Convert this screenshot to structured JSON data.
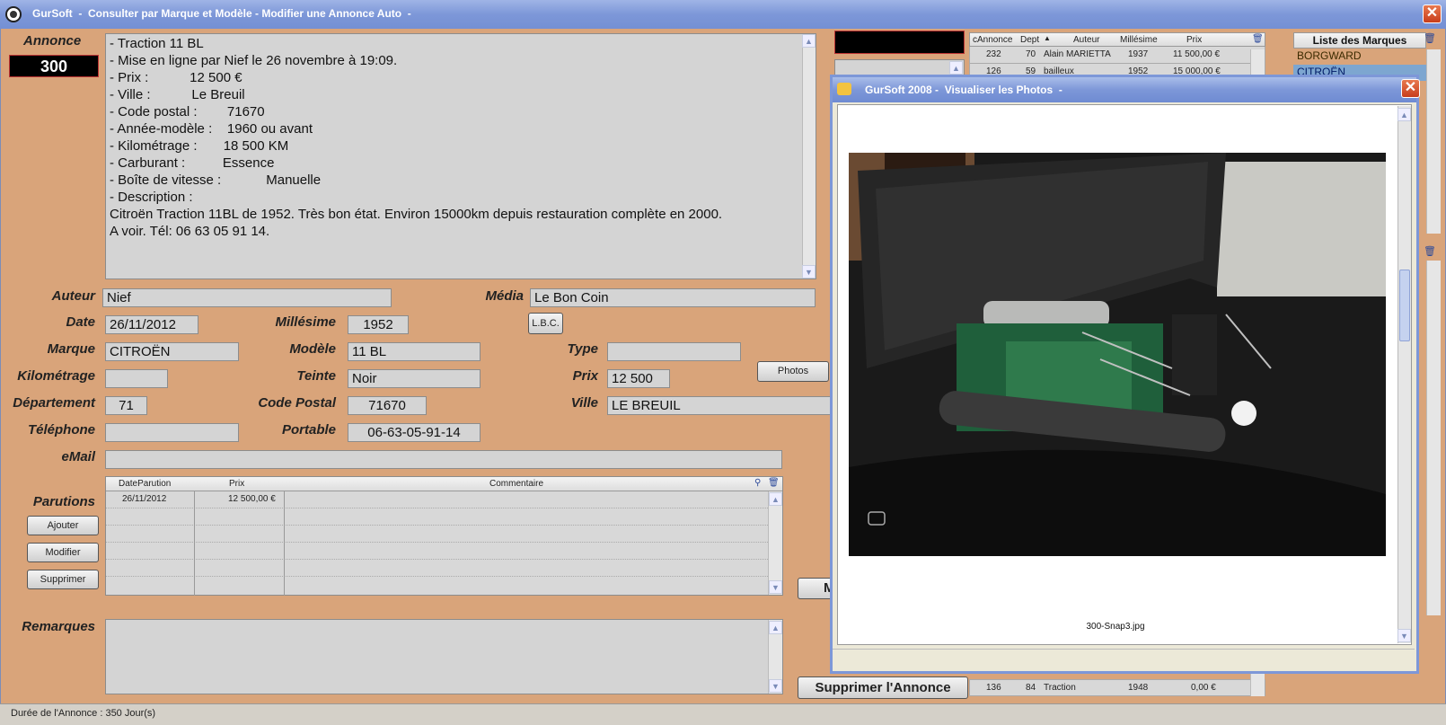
{
  "window": {
    "title": "GurSoft  -  Consulter par Marque et Modèle - Modifier une Annonce Auto  -",
    "close_label": "✕"
  },
  "annonce": {
    "label": "Annonce",
    "number": "300",
    "description_lines": [
      "- Traction 11 BL",
      "- Mise en ligne par Nief le 26 novembre à 19:09.",
      "- Prix :           12 500 €",
      "- Ville :           Le Breuil",
      "- Code postal :        71670",
      "- Année-modèle :    1960 ou avant",
      "- Kilométrage :       18 500 KM",
      "- Carburant :          Essence",
      "- Boîte de vitesse :            Manuelle",
      "- Description :",
      "Citroën Traction 11BL de 1952. Très bon état. Environ 15000km depuis restauration complète en 2000.",
      "A voir. Tél: 06 63 05 91 14."
    ]
  },
  "fields": {
    "auteur": {
      "label": "Auteur",
      "value": "Nief"
    },
    "media": {
      "label": "Média",
      "value": "Le Bon Coin"
    },
    "date": {
      "label": "Date",
      "value": "26/11/2012"
    },
    "millesime": {
      "label": "Millésime",
      "value": "1952"
    },
    "lbc_button": "L.B.C.",
    "marque": {
      "label": "Marque",
      "value": "CITROËN"
    },
    "modele": {
      "label": "Modèle",
      "value": "11 BL"
    },
    "type": {
      "label": "Type",
      "value": ""
    },
    "kilometrage": {
      "label": "Kilométrage",
      "value": ""
    },
    "teinte": {
      "label": "Teinte",
      "value": "Noir"
    },
    "prix": {
      "label": "Prix",
      "value": "12 500"
    },
    "photos_button": "Photos",
    "departement": {
      "label": "Département",
      "value": "71"
    },
    "code_postal": {
      "label": "Code Postal",
      "value": "71670"
    },
    "ville": {
      "label": "Ville",
      "value": "LE BREUIL"
    },
    "telephone": {
      "label": "Téléphone",
      "value": ""
    },
    "portable": {
      "label": "Portable",
      "value": "06-63-05-91-14"
    },
    "email": {
      "label": "eMail",
      "value": ""
    }
  },
  "parutions": {
    "label": "Parutions",
    "buttons": {
      "ajouter": "Ajouter",
      "modifier": "Modifier",
      "supprimer": "Supprimer"
    },
    "columns": [
      "DateParution",
      "Prix",
      "Commentaire"
    ],
    "rows": [
      {
        "date": "26/11/2012",
        "prix": "12 500,00 €",
        "commentaire": ""
      }
    ]
  },
  "remarques": {
    "label": "Remarques"
  },
  "supprimer_annonce": "Supprimer l'Annonce",
  "partial_button": "M",
  "status": "Durée de l'Annonce : 350 Jour(s)",
  "list_table": {
    "columns": [
      "cAnnonce",
      "Dept",
      "Auteur",
      "Millésime",
      "Prix"
    ],
    "rows": [
      {
        "c": "232",
        "d": "70",
        "a": "Alain MARIETTA",
        "m": "1937",
        "p": "11 500,00 €"
      },
      {
        "c": "126",
        "d": "59",
        "a": "bailleux",
        "m": "1952",
        "p": "15 000,00 €"
      }
    ],
    "last_row": {
      "c": "136",
      "d": "84",
      "a": "Traction",
      "m": "1948",
      "p": "0,00 €"
    }
  },
  "marques": {
    "title": "Liste des Marques",
    "items": [
      "BORGWARD",
      "CITROËN"
    ]
  },
  "photo_window": {
    "title": "GurSoft 2008 -  Visualiser les Photos  -",
    "caption": "300-Snap3.jpg"
  }
}
